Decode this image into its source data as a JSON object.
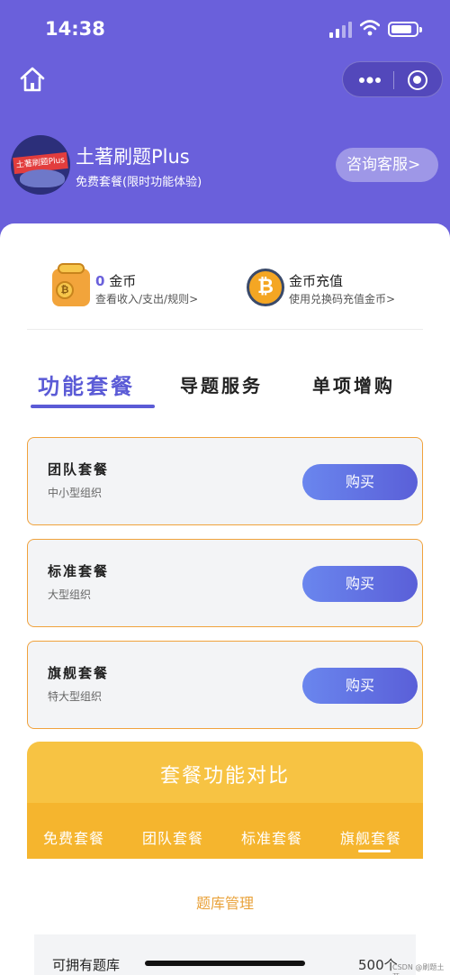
{
  "status": {
    "time": "14:38"
  },
  "profile": {
    "app_name": "土著刷题Plus",
    "avatar_text": "土著刷题Plus",
    "plan_desc": "免费套餐(限时功能体验)",
    "service_label": "咨询客服>"
  },
  "wallet": {
    "coins_count": "0",
    "coins_unit": "金币",
    "coins_link": "查看收入/支出/规则>",
    "recharge_title": "金币充值",
    "recharge_link": "使用兑换码充值金币>"
  },
  "tabs": [
    {
      "label": "功能套餐",
      "active": true
    },
    {
      "label": "导题服务",
      "active": false
    },
    {
      "label": "单项增购",
      "active": false
    }
  ],
  "packages": [
    {
      "name": "团队套餐",
      "desc": "中小型组织",
      "button": "购买"
    },
    {
      "name": "标准套餐",
      "desc": "大型组织",
      "button": "购买"
    },
    {
      "name": "旗舰套餐",
      "desc": "特大型组织",
      "button": "购买"
    }
  ],
  "compare": {
    "title": "套餐功能对比",
    "tabs": [
      "免费套餐",
      "团队套餐",
      "标准套餐",
      "旗舰套餐"
    ],
    "active_tab": "旗舰套餐",
    "section_title": "题库管理",
    "row_label": "可拥有题库",
    "row_value": "500个"
  },
  "watermark": "CSDN @刷题土著",
  "colors": {
    "primary": "#6a60db",
    "accent": "#5b5bd6",
    "gold": "#f7c343",
    "border": "#f0a23c"
  }
}
